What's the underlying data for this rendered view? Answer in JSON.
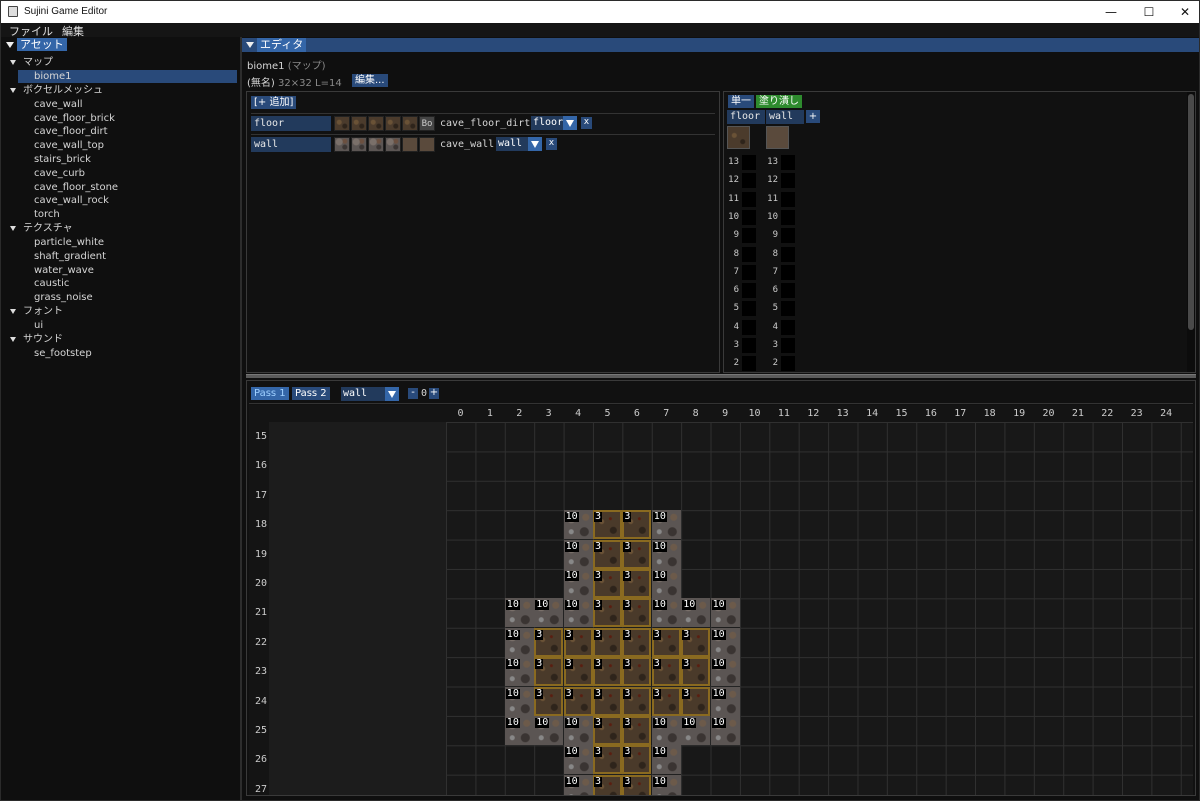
{
  "window": {
    "title": "Sujini Game Editor",
    "minimize": "—",
    "maximize": "☐",
    "close": "✕"
  },
  "menu": {
    "file": "ファイル",
    "edit": "編集"
  },
  "assets_panel": {
    "header": "アセット",
    "groups": [
      {
        "label": "マップ",
        "items": [
          "biome1"
        ]
      },
      {
        "label": "ボクセルメッシュ",
        "items": [
          "cave_wall",
          "cave_floor_brick",
          "cave_floor_dirt",
          "cave_wall_top",
          "stairs_brick",
          "cave_curb",
          "cave_floor_stone",
          "cave_wall_rock",
          "torch"
        ]
      },
      {
        "label": "テクスチャ",
        "items": [
          "particle_white",
          "shaft_gradient",
          "water_wave",
          "caustic",
          "grass_noise"
        ]
      },
      {
        "label": "フォント",
        "items": [
          "ui"
        ]
      },
      {
        "label": "サウンド",
        "items": [
          "se_footstep"
        ]
      }
    ],
    "selected": "biome1"
  },
  "editor": {
    "header": "エディタ",
    "asset_name": "biome1",
    "asset_kind": "(マップ)",
    "map_name": "(無名)",
    "map_info": "32×32 L=14",
    "edit_button": "編集..."
  },
  "palette": {
    "add_button": "[+ 追加]",
    "rows": [
      {
        "name": "floor",
        "tile_type": "dirt",
        "extra_label": "Bo",
        "mesh": "cave_floor_dirt",
        "kind": "floor",
        "remove": "x"
      },
      {
        "name": "wall",
        "tile_type": "stone",
        "extra_label": "",
        "mesh": "cave_wall",
        "kind": "wall",
        "remove": "x"
      }
    ]
  },
  "layers": {
    "mode_single": "単一",
    "mode_fill": "塗り潰し",
    "columns": [
      "floor",
      "wall"
    ],
    "add": "+",
    "rows": [
      13,
      12,
      11,
      10,
      9,
      8,
      7,
      6,
      5,
      4,
      3,
      2
    ],
    "wall_filled_from": 10
  },
  "grid_toolbar": {
    "pass1": "Pass 1",
    "pass2": "Pass 2",
    "layer_select": "wall",
    "minus": "-",
    "value": "0",
    "plus": "+"
  },
  "grid": {
    "columns": [
      "0",
      "1",
      "2",
      "3",
      "4",
      "5",
      "6",
      "7",
      "8",
      "9",
      "10",
      "11",
      "12",
      "13",
      "14",
      "15",
      "16",
      "17",
      "18",
      "19",
      "20",
      "21",
      "22",
      "23",
      "24",
      "2"
    ],
    "rows": [
      "15",
      "16",
      "17",
      "18",
      "19",
      "20",
      "21",
      "22",
      "23",
      "24",
      "25",
      "26",
      "27"
    ],
    "cells": [
      {
        "r": 18,
        "c": 4,
        "t": "wall",
        "v": "10"
      },
      {
        "r": 18,
        "c": 5,
        "t": "floor",
        "v": "3"
      },
      {
        "r": 18,
        "c": 6,
        "t": "floor",
        "v": "3"
      },
      {
        "r": 18,
        "c": 7,
        "t": "wall",
        "v": "10"
      },
      {
        "r": 19,
        "c": 4,
        "t": "wall",
        "v": "10"
      },
      {
        "r": 19,
        "c": 5,
        "t": "floor",
        "v": "3"
      },
      {
        "r": 19,
        "c": 6,
        "t": "floor",
        "v": "3"
      },
      {
        "r": 19,
        "c": 7,
        "t": "wall",
        "v": "10"
      },
      {
        "r": 20,
        "c": 4,
        "t": "wall",
        "v": "10"
      },
      {
        "r": 20,
        "c": 5,
        "t": "floor",
        "v": "3"
      },
      {
        "r": 20,
        "c": 6,
        "t": "floor",
        "v": "3"
      },
      {
        "r": 20,
        "c": 7,
        "t": "wall",
        "v": "10"
      },
      {
        "r": 21,
        "c": 2,
        "t": "wall",
        "v": "10"
      },
      {
        "r": 21,
        "c": 3,
        "t": "wall",
        "v": "10"
      },
      {
        "r": 21,
        "c": 4,
        "t": "wall",
        "v": "10"
      },
      {
        "r": 21,
        "c": 5,
        "t": "floor",
        "v": "3"
      },
      {
        "r": 21,
        "c": 6,
        "t": "floor",
        "v": "3"
      },
      {
        "r": 21,
        "c": 7,
        "t": "wall",
        "v": "10"
      },
      {
        "r": 21,
        "c": 8,
        "t": "wall",
        "v": "10"
      },
      {
        "r": 21,
        "c": 9,
        "t": "wall",
        "v": "10"
      },
      {
        "r": 22,
        "c": 2,
        "t": "wall",
        "v": "10"
      },
      {
        "r": 22,
        "c": 3,
        "t": "floor",
        "v": "3"
      },
      {
        "r": 22,
        "c": 4,
        "t": "floor",
        "v": "3"
      },
      {
        "r": 22,
        "c": 5,
        "t": "floor",
        "v": "3"
      },
      {
        "r": 22,
        "c": 6,
        "t": "floor",
        "v": "3"
      },
      {
        "r": 22,
        "c": 7,
        "t": "floor",
        "v": "3"
      },
      {
        "r": 22,
        "c": 8,
        "t": "floor",
        "v": "3"
      },
      {
        "r": 22,
        "c": 9,
        "t": "wall",
        "v": "10"
      },
      {
        "r": 23,
        "c": 2,
        "t": "wall",
        "v": "10"
      },
      {
        "r": 23,
        "c": 3,
        "t": "floor",
        "v": "3"
      },
      {
        "r": 23,
        "c": 4,
        "t": "floor",
        "v": "3"
      },
      {
        "r": 23,
        "c": 5,
        "t": "floor",
        "v": "3"
      },
      {
        "r": 23,
        "c": 6,
        "t": "floor",
        "v": "3"
      },
      {
        "r": 23,
        "c": 7,
        "t": "floor",
        "v": "3"
      },
      {
        "r": 23,
        "c": 8,
        "t": "floor",
        "v": "3"
      },
      {
        "r": 23,
        "c": 9,
        "t": "wall",
        "v": "10"
      },
      {
        "r": 24,
        "c": 2,
        "t": "wall",
        "v": "10"
      },
      {
        "r": 24,
        "c": 3,
        "t": "floor",
        "v": "3"
      },
      {
        "r": 24,
        "c": 4,
        "t": "floor",
        "v": "3"
      },
      {
        "r": 24,
        "c": 5,
        "t": "floor",
        "v": "3"
      },
      {
        "r": 24,
        "c": 6,
        "t": "floor",
        "v": "3"
      },
      {
        "r": 24,
        "c": 7,
        "t": "floor",
        "v": "3"
      },
      {
        "r": 24,
        "c": 8,
        "t": "floor",
        "v": "3"
      },
      {
        "r": 24,
        "c": 9,
        "t": "wall",
        "v": "10"
      },
      {
        "r": 25,
        "c": 2,
        "t": "wall",
        "v": "10"
      },
      {
        "r": 25,
        "c": 3,
        "t": "wall",
        "v": "10"
      },
      {
        "r": 25,
        "c": 4,
        "t": "wall",
        "v": "10"
      },
      {
        "r": 25,
        "c": 5,
        "t": "floor",
        "v": "3"
      },
      {
        "r": 25,
        "c": 6,
        "t": "floor",
        "v": "3"
      },
      {
        "r": 25,
        "c": 7,
        "t": "wall",
        "v": "10"
      },
      {
        "r": 25,
        "c": 8,
        "t": "wall",
        "v": "10"
      },
      {
        "r": 25,
        "c": 9,
        "t": "wall",
        "v": "10"
      },
      {
        "r": 26,
        "c": 4,
        "t": "wall",
        "v": "10"
      },
      {
        "r": 26,
        "c": 5,
        "t": "floor",
        "v": "3"
      },
      {
        "r": 26,
        "c": 6,
        "t": "floor",
        "v": "3"
      },
      {
        "r": 26,
        "c": 7,
        "t": "wall",
        "v": "10"
      },
      {
        "r": 27,
        "c": 4,
        "t": "wall",
        "v": "10"
      },
      {
        "r": 27,
        "c": 5,
        "t": "floor",
        "v": "3"
      },
      {
        "r": 27,
        "c": 6,
        "t": "floor",
        "v": "3"
      },
      {
        "r": 27,
        "c": 7,
        "t": "wall",
        "v": "10"
      }
    ]
  },
  "colors": {
    "accent": "#294a7a",
    "accent_light": "#3466a8",
    "fill_green": "#2e8b2e",
    "background": "#0f0f0f"
  }
}
